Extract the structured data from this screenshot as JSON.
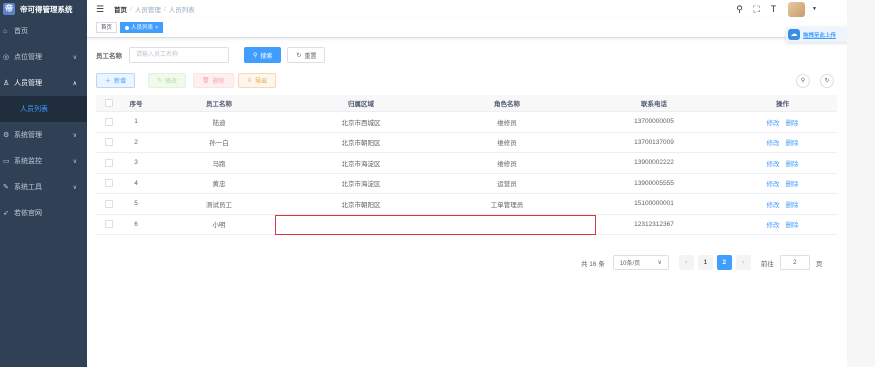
{
  "app": {
    "title": "帝可得管理系统"
  },
  "sidebar": {
    "items": [
      {
        "label": "首页",
        "icon": "home-icon"
      },
      {
        "label": "点位管理",
        "icon": "location-icon"
      },
      {
        "label": "人员管理",
        "icon": "user-icon",
        "open": true
      },
      {
        "label": "人员列表",
        "sub": true,
        "active": true
      },
      {
        "label": "系统管理",
        "icon": "gear-icon"
      },
      {
        "label": "系统监控",
        "icon": "monitor-icon"
      },
      {
        "label": "系统工具",
        "icon": "tool-icon"
      },
      {
        "label": "若依官网",
        "icon": "guide-icon"
      }
    ]
  },
  "breadcrumb": {
    "items": [
      "首页",
      "人员管理",
      "人员列表"
    ]
  },
  "tags": {
    "home": "首页",
    "active": "人员列表"
  },
  "upload_tip": "拖拽至此上传",
  "search": {
    "label": "员工名称",
    "placeholder": "请输入员工名称",
    "search_btn": "搜索",
    "reset_btn": "重置"
  },
  "toolbar": {
    "add": "新增",
    "edit": "修改",
    "delete": "删除",
    "export": "导出"
  },
  "table": {
    "headers": [
      "序号",
      "员工名称",
      "归属区域",
      "角色名称",
      "联系电话",
      "操作"
    ],
    "rows": [
      [
        "1",
        "陆迪",
        "北京市西城区",
        "维修员",
        "13700000005"
      ],
      [
        "2",
        "孙一白",
        "北京市朝阳区",
        "维修员",
        "13700137009"
      ],
      [
        "3",
        "马跑",
        "北京市海淀区",
        "维修员",
        "13900002222"
      ],
      [
        "4",
        "黄忠",
        "北京市海淀区",
        "运营员",
        "13900005555"
      ],
      [
        "5",
        "测试员工",
        "北京市朝阳区",
        "工单管理员",
        "15100000001"
      ],
      [
        "6",
        "小明",
        "",
        "",
        "12312312367"
      ]
    ],
    "op_edit": "修改",
    "op_delete": "删除"
  },
  "pagination": {
    "total": "共 16 条",
    "page_size": "10条/页",
    "pages": [
      "1",
      "2"
    ],
    "current": "2",
    "goto_label": "前往",
    "goto_value": "2",
    "page_unit": "页"
  },
  "colors": {
    "primary": "#409eff",
    "sidebar_bg": "#304156",
    "highlight_border": "#d9363e"
  }
}
